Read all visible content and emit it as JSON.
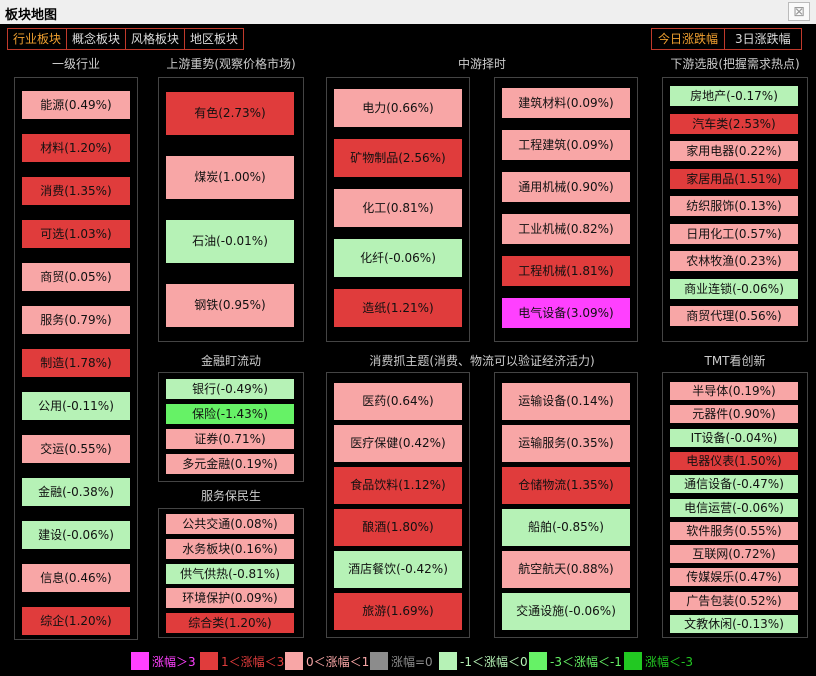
{
  "window": {
    "title": "板块地图",
    "close_glyph": "⊠"
  },
  "tabs_left": [
    "行业板块",
    "概念板块",
    "风格板块",
    "地区板块"
  ],
  "tabs_right": [
    "今日涨跌幅",
    "3日涨跌幅"
  ],
  "colors": {
    "up3": "#ff40ff",
    "up1_3": "#e03c3c",
    "up0_1": "#f8a6a6",
    "flat": "#8c8c8c",
    "down0_1": "#b6f2b6",
    "down1_3": "#66f266",
    "down3": "#22c822"
  },
  "sections": {
    "yiji": "一级行业",
    "upstream": "上游重势(观察价格市场)",
    "midstream": "中游择时",
    "downstream": "下游选股(把握需求热点)",
    "finance": "金融盯流动",
    "consumer": "消费抓主题(消费、物流可以验证经济活力)",
    "tmt": "TMT看创新",
    "service": "服务保民生"
  },
  "tiles": {
    "yiji": [
      {
        "label": "能源(0.49%)",
        "change": 0.49
      },
      {
        "label": "材料(1.20%)",
        "change": 1.2
      },
      {
        "label": "消费(1.35%)",
        "change": 1.35
      },
      {
        "label": "可选(1.03%)",
        "change": 1.03
      },
      {
        "label": "商贸(0.05%)",
        "change": 0.05
      },
      {
        "label": "服务(0.79%)",
        "change": 0.79
      },
      {
        "label": "制造(1.78%)",
        "change": 1.78
      },
      {
        "label": "公用(-0.11%)",
        "change": -0.11
      },
      {
        "label": "交运(0.55%)",
        "change": 0.55
      },
      {
        "label": "金融(-0.38%)",
        "change": -0.38
      },
      {
        "label": "建设(-0.06%)",
        "change": -0.06
      },
      {
        "label": "信息(0.46%)",
        "change": 0.46
      },
      {
        "label": "综企(1.20%)",
        "change": 1.2
      }
    ],
    "upstream": [
      {
        "label": "有色(2.73%)",
        "change": 2.73
      },
      {
        "label": "煤炭(1.00%)",
        "change": 1.0
      },
      {
        "label": "石油(-0.01%)",
        "change": -0.01
      },
      {
        "label": "钢铁(0.95%)",
        "change": 0.95
      }
    ],
    "mid_a": [
      {
        "label": "电力(0.66%)",
        "change": 0.66
      },
      {
        "label": "矿物制品(2.56%)",
        "change": 2.56
      },
      {
        "label": "化工(0.81%)",
        "change": 0.81
      },
      {
        "label": "化纤(-0.06%)",
        "change": -0.06
      },
      {
        "label": "造纸(1.21%)",
        "change": 1.21
      }
    ],
    "mid_b": [
      {
        "label": "建筑材料(0.09%)",
        "change": 0.09
      },
      {
        "label": "工程建筑(0.09%)",
        "change": 0.09
      },
      {
        "label": "通用机械(0.90%)",
        "change": 0.9
      },
      {
        "label": "工业机械(0.82%)",
        "change": 0.82
      },
      {
        "label": "工程机械(1.81%)",
        "change": 1.81
      },
      {
        "label": "电气设备(3.09%)",
        "change": 3.09
      }
    ],
    "downstream": [
      {
        "label": "房地产(-0.17%)",
        "change": -0.17
      },
      {
        "label": "汽车类(2.53%)",
        "change": 2.53
      },
      {
        "label": "家用电器(0.22%)",
        "change": 0.22
      },
      {
        "label": "家居用品(1.51%)",
        "change": 1.51
      },
      {
        "label": "纺织服饰(0.13%)",
        "change": 0.13
      },
      {
        "label": "日用化工(0.57%)",
        "change": 0.57
      },
      {
        "label": "农林牧渔(0.23%)",
        "change": 0.23
      },
      {
        "label": "商业连锁(-0.06%)",
        "change": -0.06
      },
      {
        "label": "商贸代理(0.56%)",
        "change": 0.56
      }
    ],
    "finance": [
      {
        "label": "银行(-0.49%)",
        "change": -0.49
      },
      {
        "label": "保险(-1.43%)",
        "change": -1.43
      },
      {
        "label": "证券(0.71%)",
        "change": 0.71
      },
      {
        "label": "多元金融(0.19%)",
        "change": 0.19
      }
    ],
    "service": [
      {
        "label": "公共交通(0.08%)",
        "change": 0.08
      },
      {
        "label": "水务板块(0.16%)",
        "change": 0.16
      },
      {
        "label": "供气供热(-0.81%)",
        "change": -0.81
      },
      {
        "label": "环境保护(0.09%)",
        "change": 0.09
      },
      {
        "label": "综合类(1.20%)",
        "change": 1.2
      }
    ],
    "cons_a": [
      {
        "label": "医药(0.64%)",
        "change": 0.64
      },
      {
        "label": "医疗保健(0.42%)",
        "change": 0.42
      },
      {
        "label": "食品饮料(1.12%)",
        "change": 1.12
      },
      {
        "label": "酿酒(1.80%)",
        "change": 1.8
      },
      {
        "label": "酒店餐饮(-0.42%)",
        "change": -0.42
      },
      {
        "label": "旅游(1.69%)",
        "change": 1.69
      }
    ],
    "cons_b": [
      {
        "label": "运输设备(0.14%)",
        "change": 0.14
      },
      {
        "label": "运输服务(0.35%)",
        "change": 0.35
      },
      {
        "label": "仓储物流(1.35%)",
        "change": 1.35
      },
      {
        "label": "船舶(-0.85%)",
        "change": -0.85
      },
      {
        "label": "航空航天(0.88%)",
        "change": 0.88
      },
      {
        "label": "交通设施(-0.06%)",
        "change": -0.06
      }
    ],
    "tmt": [
      {
        "label": "半导体(0.19%)",
        "change": 0.19
      },
      {
        "label": "元器件(0.90%)",
        "change": 0.9
      },
      {
        "label": "IT设备(-0.04%)",
        "change": -0.04
      },
      {
        "label": "电器仪表(1.50%)",
        "change": 1.5
      },
      {
        "label": "通信设备(-0.47%)",
        "change": -0.47
      },
      {
        "label": "电信运营(-0.06%)",
        "change": -0.06
      },
      {
        "label": "软件服务(0.55%)",
        "change": 0.55
      },
      {
        "label": "互联网(0.72%)",
        "change": 0.72
      },
      {
        "label": "传媒娱乐(0.47%)",
        "change": 0.47
      },
      {
        "label": "广告包装(0.52%)",
        "change": 0.52
      },
      {
        "label": "文教休闲(-0.13%)",
        "change": -0.13
      }
    ]
  },
  "legend": [
    {
      "color": "#ff40ff",
      "text": "涨幅＞3",
      "text_color": "#ff40ff"
    },
    {
      "color": "#e03c3c",
      "text": "1＜涨幅＜3",
      "text_color": "#e03c3c"
    },
    {
      "color": "#f8a6a6",
      "text": "0＜涨幅＜1",
      "text_color": "#f8a6a6"
    },
    {
      "color": "#8c8c8c",
      "text": "涨幅=0",
      "text_color": "#8c8c8c"
    },
    {
      "color": "#b6f2b6",
      "text": "-1＜涨幅＜0",
      "text_color": "#b6f2b6"
    },
    {
      "color": "#66f266",
      "text": "-3＜涨幅＜-1",
      "text_color": "#66f266"
    },
    {
      "color": "#22c822",
      "text": "涨幅＜-3",
      "text_color": "#22c822"
    }
  ]
}
